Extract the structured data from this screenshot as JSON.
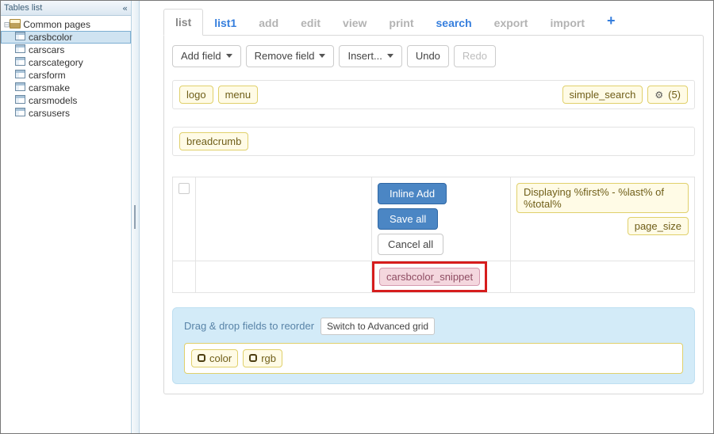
{
  "sidebar": {
    "title": "Tables list",
    "collapse_glyph": "«",
    "common_label": "Common pages",
    "items": [
      {
        "label": "carsbcolor",
        "selected": true
      },
      {
        "label": "carscars",
        "selected": false
      },
      {
        "label": "carscategory",
        "selected": false
      },
      {
        "label": "carsform",
        "selected": false
      },
      {
        "label": "carsmake",
        "selected": false
      },
      {
        "label": "carsmodels",
        "selected": false
      },
      {
        "label": "carsusers",
        "selected": false
      }
    ]
  },
  "tabs": [
    {
      "label": "list",
      "state": "active"
    },
    {
      "label": "list1",
      "state": "blue"
    },
    {
      "label": "add",
      "state": "gray"
    },
    {
      "label": "edit",
      "state": "gray"
    },
    {
      "label": "view",
      "state": "gray"
    },
    {
      "label": "print",
      "state": "gray"
    },
    {
      "label": "search",
      "state": "blue"
    },
    {
      "label": "export",
      "state": "gray"
    },
    {
      "label": "import",
      "state": "gray"
    }
  ],
  "toolbar": {
    "add_field": "Add field",
    "remove_field": "Remove field",
    "insert": "Insert...",
    "undo": "Undo",
    "redo": "Redo"
  },
  "header_row": {
    "logo": "logo",
    "menu": "menu",
    "simple_search": "simple_search",
    "settings_count": "(5)"
  },
  "breadcrumb_row": {
    "breadcrumb": "breadcrumb"
  },
  "grid": {
    "inline_add": "Inline Add",
    "save_all": "Save all",
    "cancel_all": "Cancel all",
    "paging_text": "Displaying %first% - %last% of %total%",
    "page_size": "page_size",
    "snippet": "carsbcolor_snippet"
  },
  "reorder": {
    "hint": "Drag & drop fields to reorder",
    "switch": "Switch to Advanced grid",
    "fields": [
      {
        "label": "color"
      },
      {
        "label": "rgb"
      }
    ]
  }
}
